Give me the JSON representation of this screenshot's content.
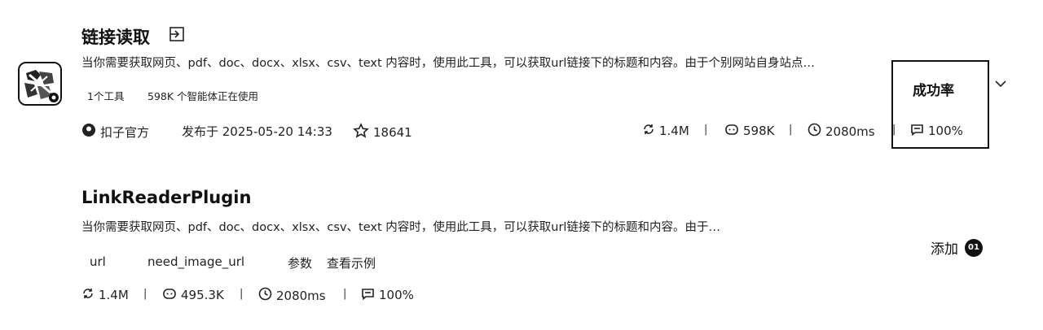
{
  "plugin": {
    "title": "链接读取",
    "description": "当你需要获取网页、pdf、doc、docx、xlsx、csv、text 内容时，使用此工具，可以获取url链接下的标题和内容。由于个别网站自身站点…",
    "tool_count": "1个工具",
    "agents_using": "598K 个智能体正在使用",
    "publisher": "扣子官方",
    "published_at": "发布于 2025-05-20 14:33",
    "favorites": "18641",
    "stats": {
      "calls": "1.4M",
      "bots": "598K",
      "latency": "2080ms",
      "success": "100%"
    },
    "tooltip_label": "成功率"
  },
  "tool": {
    "title": "LinkReaderPlugin",
    "description": "当你需要获取网页、pdf、doc、docx、xlsx、csv、text 内容时，使用此工具，可以获取url链接下的标题和内容。由于…",
    "params": [
      "url",
      "need_image_url"
    ],
    "params_label": "参数",
    "example_link": "查看示例",
    "stats": {
      "calls": "1.4M",
      "bots": "495.3K",
      "latency": "2080ms",
      "success": "100%"
    },
    "add_label": "添加",
    "add_badge": "01"
  },
  "icons": {
    "title_action": "enter-arrow-icon",
    "publisher": "coze-logo-icon",
    "favorite": "star-icon",
    "calls": "refresh-icon",
    "bots": "bot-icon",
    "latency": "clock-icon",
    "success": "message-icon",
    "expand": "chevron-down-icon"
  }
}
